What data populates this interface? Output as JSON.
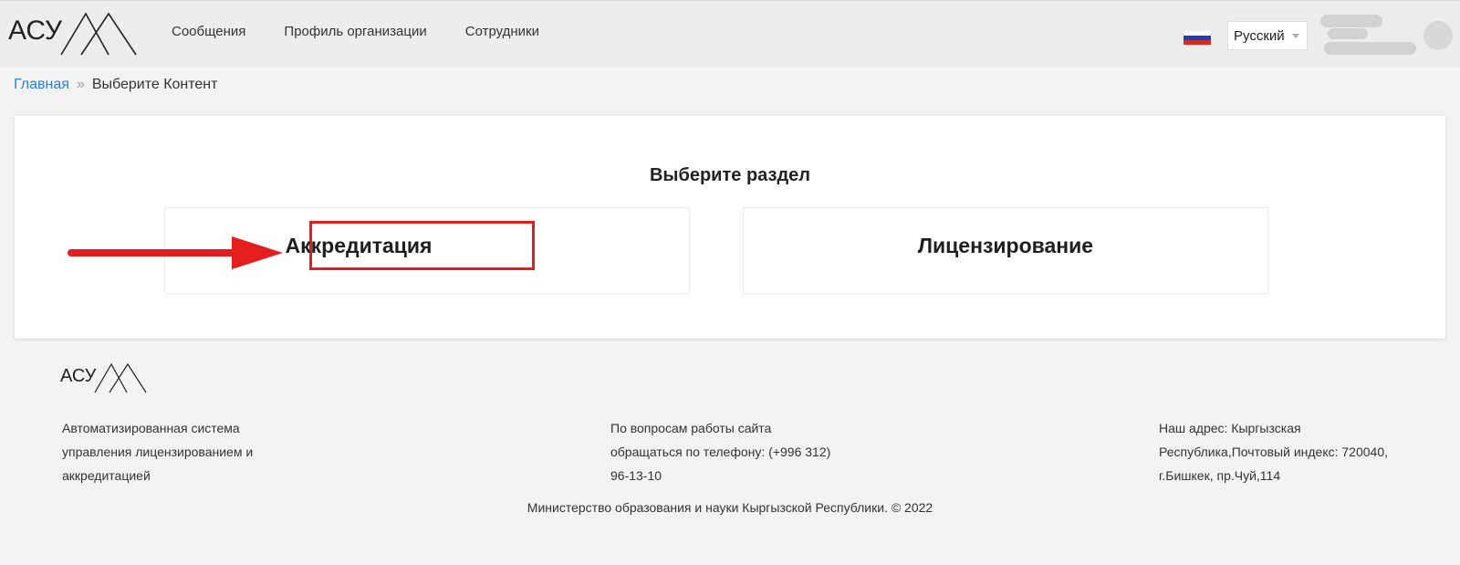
{
  "header": {
    "logo_text": "АСУЛА",
    "nav": [
      {
        "label": "Сообщения"
      },
      {
        "label": "Профиль организации"
      },
      {
        "label": "Сотрудники"
      }
    ],
    "language": "Русский",
    "flag_colors": [
      "#ffffff",
      "#1f3fbf",
      "#d52b1e"
    ]
  },
  "breadcrumb": {
    "home": "Главная",
    "separator": "»",
    "current": "Выберите Контент"
  },
  "main": {
    "title": "Выберите раздел",
    "options": [
      {
        "label": "Аккредитация"
      },
      {
        "label": "Лицензирование"
      }
    ],
    "highlight_color": "#e41e1e"
  },
  "footer": {
    "logo_text": "АСУЛА",
    "about_lines": [
      "Автоматизированная система",
      "управления лицензированием и",
      "аккредитацией"
    ],
    "contact_lines": [
      "По вопросам работы сайта",
      "обращаться по телефону: (+996 312)",
      "96-13-10"
    ],
    "address_lines": [
      "Наш адрес: Кыргызская",
      "Республика,Почтовый индекс: 720040,",
      "г.Бишкек, пр.Чуй,114"
    ],
    "copyright": "Министерство образования и науки Кыргызской Республики. © 2022"
  }
}
